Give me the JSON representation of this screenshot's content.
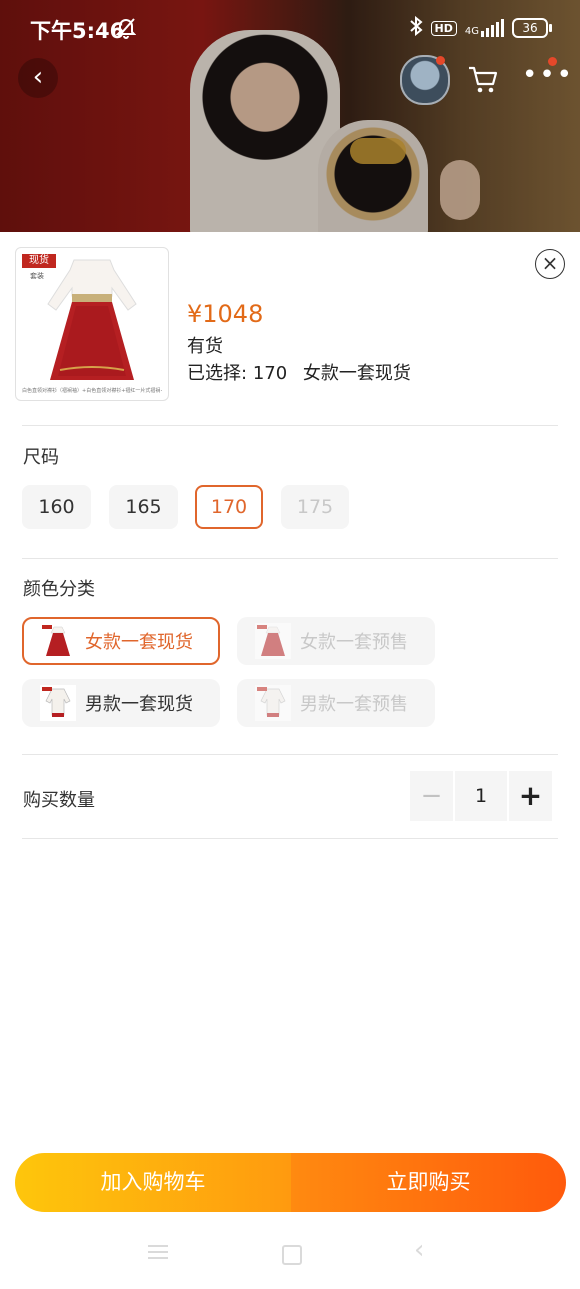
{
  "status_bar": {
    "time": "下午5:46",
    "hd": "HD",
    "network": "4G",
    "battery": "36"
  },
  "icons": {
    "back": "chevron-left-icon",
    "cart": "shopping-cart-icon",
    "more": "more-dots-icon",
    "close": "close-circle-icon",
    "minus": "minus-icon",
    "plus": "plus-icon"
  },
  "product": {
    "thumb_stamp": "现货",
    "thumb_sub": "套装",
    "thumb_caption": "白色直领对襟衫（褶裥袖）+白色直领对襟衫+褶红一片式褶裥+白色吊带",
    "price": "¥1048",
    "stock_status": "有货",
    "selected_label": "已选择:",
    "selected_size": "170",
    "selected_color": "女款一套现货"
  },
  "size_section": {
    "title": "尺码",
    "options": [
      {
        "label": "160",
        "state": "normal"
      },
      {
        "label": "165",
        "state": "normal"
      },
      {
        "label": "170",
        "state": "selected"
      },
      {
        "label": "175",
        "state": "disabled"
      }
    ]
  },
  "color_section": {
    "title": "颜色分类",
    "options": [
      {
        "label": "女款一套现货",
        "state": "selected"
      },
      {
        "label": "女款一套预售",
        "state": "disabled"
      },
      {
        "label": "男款一套现货",
        "state": "normal"
      },
      {
        "label": "男款一套预售",
        "state": "disabled"
      }
    ]
  },
  "quantity": {
    "label": "购买数量",
    "minus": "−",
    "value": "1",
    "plus": "+"
  },
  "actions": {
    "add_to_cart": "加入购物车",
    "buy_now": "立即购买"
  },
  "colors": {
    "accent": "#e0662c",
    "price": "#e26a18",
    "cart_gradient": [
      "#fec60c",
      "#ff9a0f"
    ],
    "buy_gradient": [
      "#ff8a10",
      "#ff5a0c"
    ]
  }
}
